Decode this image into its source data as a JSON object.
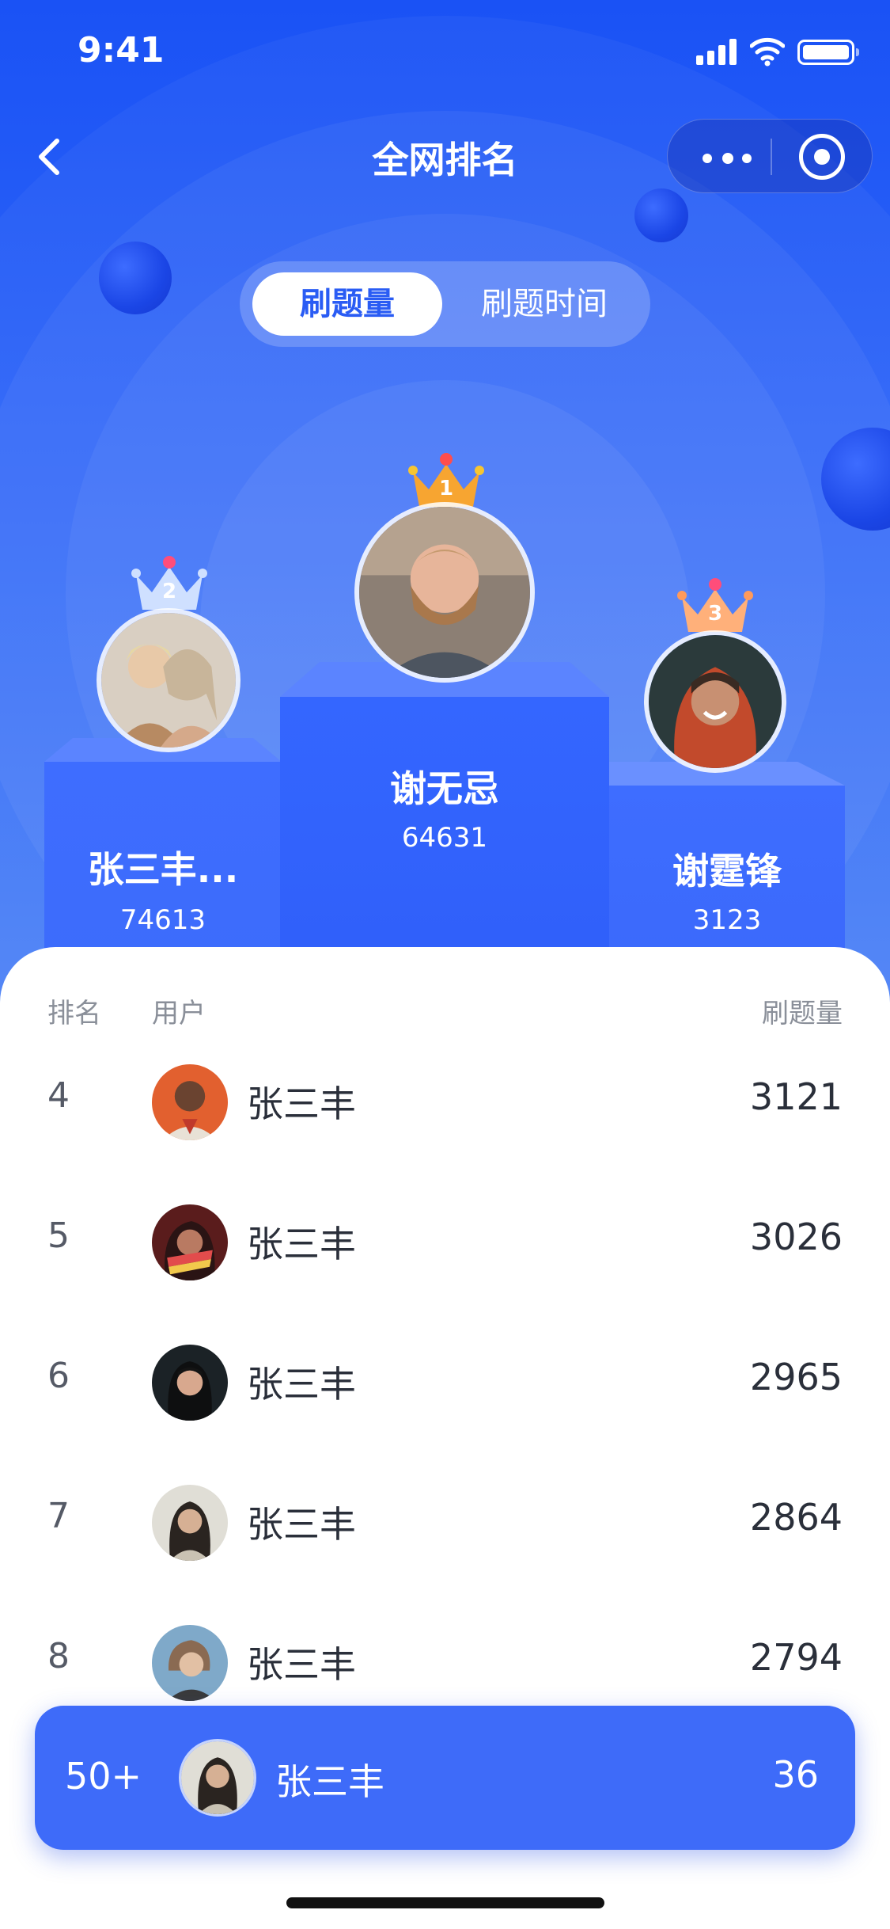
{
  "status_bar": {
    "time": "9:41"
  },
  "nav": {
    "title": "全网排名"
  },
  "tabs": [
    {
      "label": "刷题量",
      "active": true
    },
    {
      "label": "刷题时间",
      "active": false
    }
  ],
  "podium": {
    "first": {
      "rank": "1",
      "name": "谢无忌",
      "score": "64631"
    },
    "second": {
      "rank": "2",
      "name": "张三丰...",
      "score": "74613"
    },
    "third": {
      "rank": "3",
      "name": "谢霆锋",
      "score": "3123"
    }
  },
  "list": {
    "header": {
      "rank": "排名",
      "user": "用户",
      "count": "刷题量"
    },
    "rows": [
      {
        "rank": "4",
        "name": "张三丰",
        "count": "3121"
      },
      {
        "rank": "5",
        "name": "张三丰",
        "count": "3026"
      },
      {
        "rank": "6",
        "name": "张三丰",
        "count": "2965"
      },
      {
        "rank": "7",
        "name": "张三丰",
        "count": "2864"
      },
      {
        "rank": "8",
        "name": "张三丰",
        "count": "2794"
      }
    ]
  },
  "my_rank": {
    "rank": "50+",
    "name": "张三丰",
    "count": "36"
  },
  "colors": {
    "primary": "#3e6bf9",
    "hero_top": "#1a52f5",
    "crown_gold": "#f7a531",
    "crown_silver": "#cfe0ff",
    "crown_bronze": "#ffb07a"
  }
}
